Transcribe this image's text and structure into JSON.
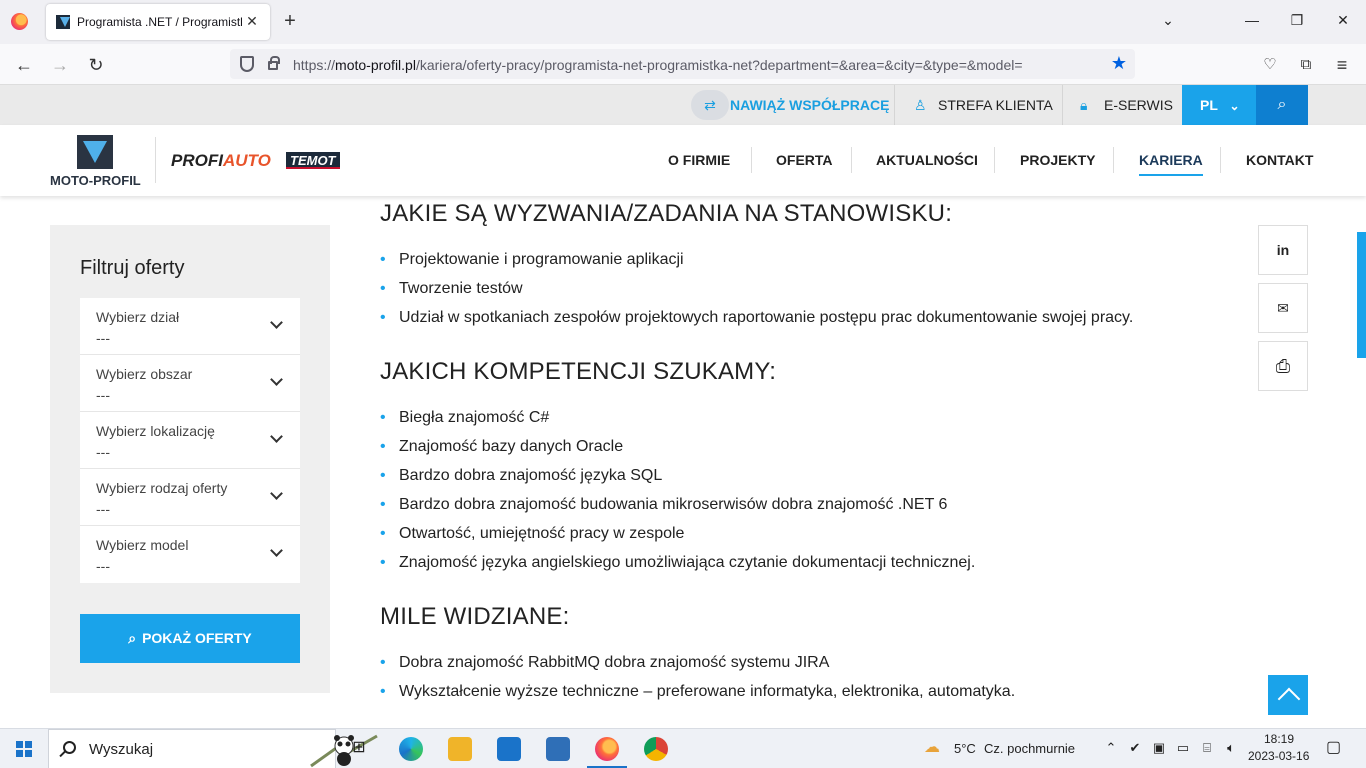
{
  "browser": {
    "tab_title": "Programista .NET / Programistka .NET",
    "new_tab": "+",
    "close_tab": "✕",
    "url_prefix": "https://",
    "url_host": "moto-profil.pl",
    "url_path": "/kariera/oferty-pracy/programista-net-programistka-net?department=&area=&city=&type=&model="
  },
  "topbar": {
    "partner_label": "NAWIĄŻ WSPÓŁPRACĘ",
    "client_zone": "STREFA KLIENTA",
    "eservice": "E-SERWIS",
    "language": "PL"
  },
  "logos": {
    "moto_profil": "MOTO-PROFIL",
    "profiauto_a": "PROFI",
    "profiauto_b": "AUTO",
    "temot": "TEMOT"
  },
  "mainnav": [
    "O FIRMIE",
    "OFERTA",
    "AKTUALNOŚCI",
    "PROJEKTY",
    "KARIERA",
    "KONTAKT"
  ],
  "mainnav_active": "KARIERA",
  "filter": {
    "title": "Filtruj oferty",
    "rows": [
      {
        "label": "Wybierz dział",
        "value": "---"
      },
      {
        "label": "Wybierz obszar",
        "value": "---"
      },
      {
        "label": "Wybierz lokalizację",
        "value": "---"
      },
      {
        "label": "Wybierz rodzaj oferty",
        "value": "---"
      },
      {
        "label": "Wybierz model",
        "value": "---"
      }
    ],
    "button": "POKAŻ OFERTY"
  },
  "content": {
    "sections": [
      {
        "title": "JAKIE SĄ WYZWANIA/ZADANIA NA STANOWISKU:",
        "items": [
          "Projektowanie i programowanie aplikacji",
          "Tworzenie testów",
          "Udział w spotkaniach zespołów projektowych raportowanie postępu prac dokumentowanie swojej pracy."
        ]
      },
      {
        "title": "JAKICH KOMPETENCJI SZUKAMY:",
        "items": [
          "Biegła znajomość C#",
          "Znajomość bazy danych Oracle",
          "Bardzo dobra znajomość języka SQL",
          "Bardzo dobra znajomość budowania mikroserwisów dobra znajomość .NET 6",
          "Otwartość, umiejętność pracy w zespole",
          "Znajomość języka angielskiego umożliwiająca czytanie dokumentacji technicznej."
        ]
      },
      {
        "title": "MILE WIDZIANE:",
        "items": [
          "Dobra znajomość RabbitMQ dobra znajomość systemu JIRA",
          "Wykształcenie wyższe techniczne – preferowane informatyka, elektronika, automatyka."
        ]
      }
    ]
  },
  "share": {
    "linkedin": "in",
    "email": "✉",
    "print": "⎙"
  },
  "taskbar": {
    "search_placeholder": "Wyszukaj",
    "weather_temp": "5°C",
    "weather_desc": "Cz. pochmurnie",
    "time": "18:19",
    "date": "2023-03-16"
  },
  "colors": {
    "accent": "#1aa3ea",
    "accent_dark": "#0e7fd0",
    "filter_bg": "#efefef",
    "topbar_bg": "#eaeaea"
  }
}
